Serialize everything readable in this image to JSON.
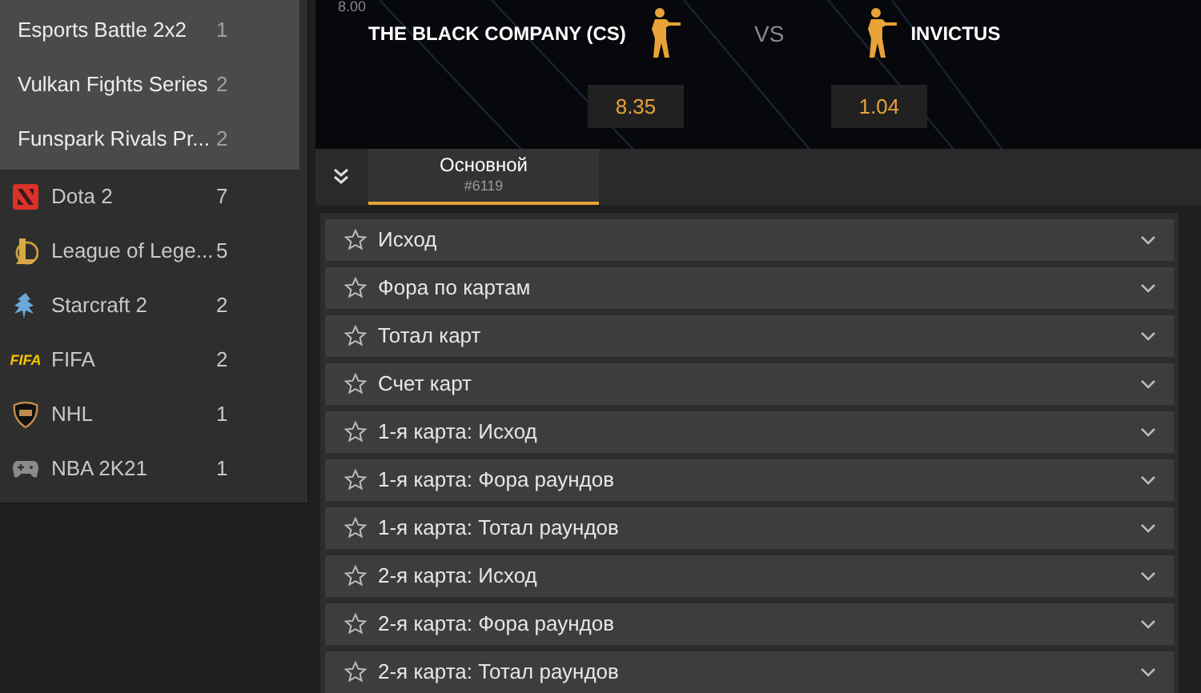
{
  "sidebar": {
    "leagues": [
      {
        "name": "Esports Battle 2x2",
        "count": "1"
      },
      {
        "name": "Vulkan Fights Series",
        "count": "2"
      },
      {
        "name": "Funspark Rivals Pr...",
        "count": "2"
      }
    ],
    "sports": [
      {
        "name": "Dota 2",
        "count": "7",
        "kind": "dota"
      },
      {
        "name": "League of Lege...",
        "count": "5",
        "kind": "lol"
      },
      {
        "name": "Starcraft 2",
        "count": "2",
        "kind": "starcraft"
      },
      {
        "name": "FIFA",
        "count": "2",
        "kind": "fifa",
        "logo_text": "FIFA"
      },
      {
        "name": "NHL",
        "count": "1",
        "kind": "nhl"
      },
      {
        "name": "NBA 2K21",
        "count": "1",
        "kind": "gamepad"
      }
    ]
  },
  "match": {
    "time": "8.00",
    "team_1": "THE BLACK COMPANY (CS)",
    "vs": "VS",
    "team_2": "INVICTUS",
    "odds_1": "8.35",
    "odds_2": "1.04"
  },
  "tabs": [
    {
      "label": "Основной",
      "sub": "#6119",
      "selected": true
    }
  ],
  "markets": [
    "Исход",
    "Фора по картам",
    "Тотал карт",
    "Счет карт",
    "1-я карта: Исход",
    "1-я карта: Фора раундов",
    "1-я карта: Тотал раундов",
    "2-я карта: Исход",
    "2-я карта: Фора раундов",
    "2-я карта: Тотал раундов"
  ]
}
